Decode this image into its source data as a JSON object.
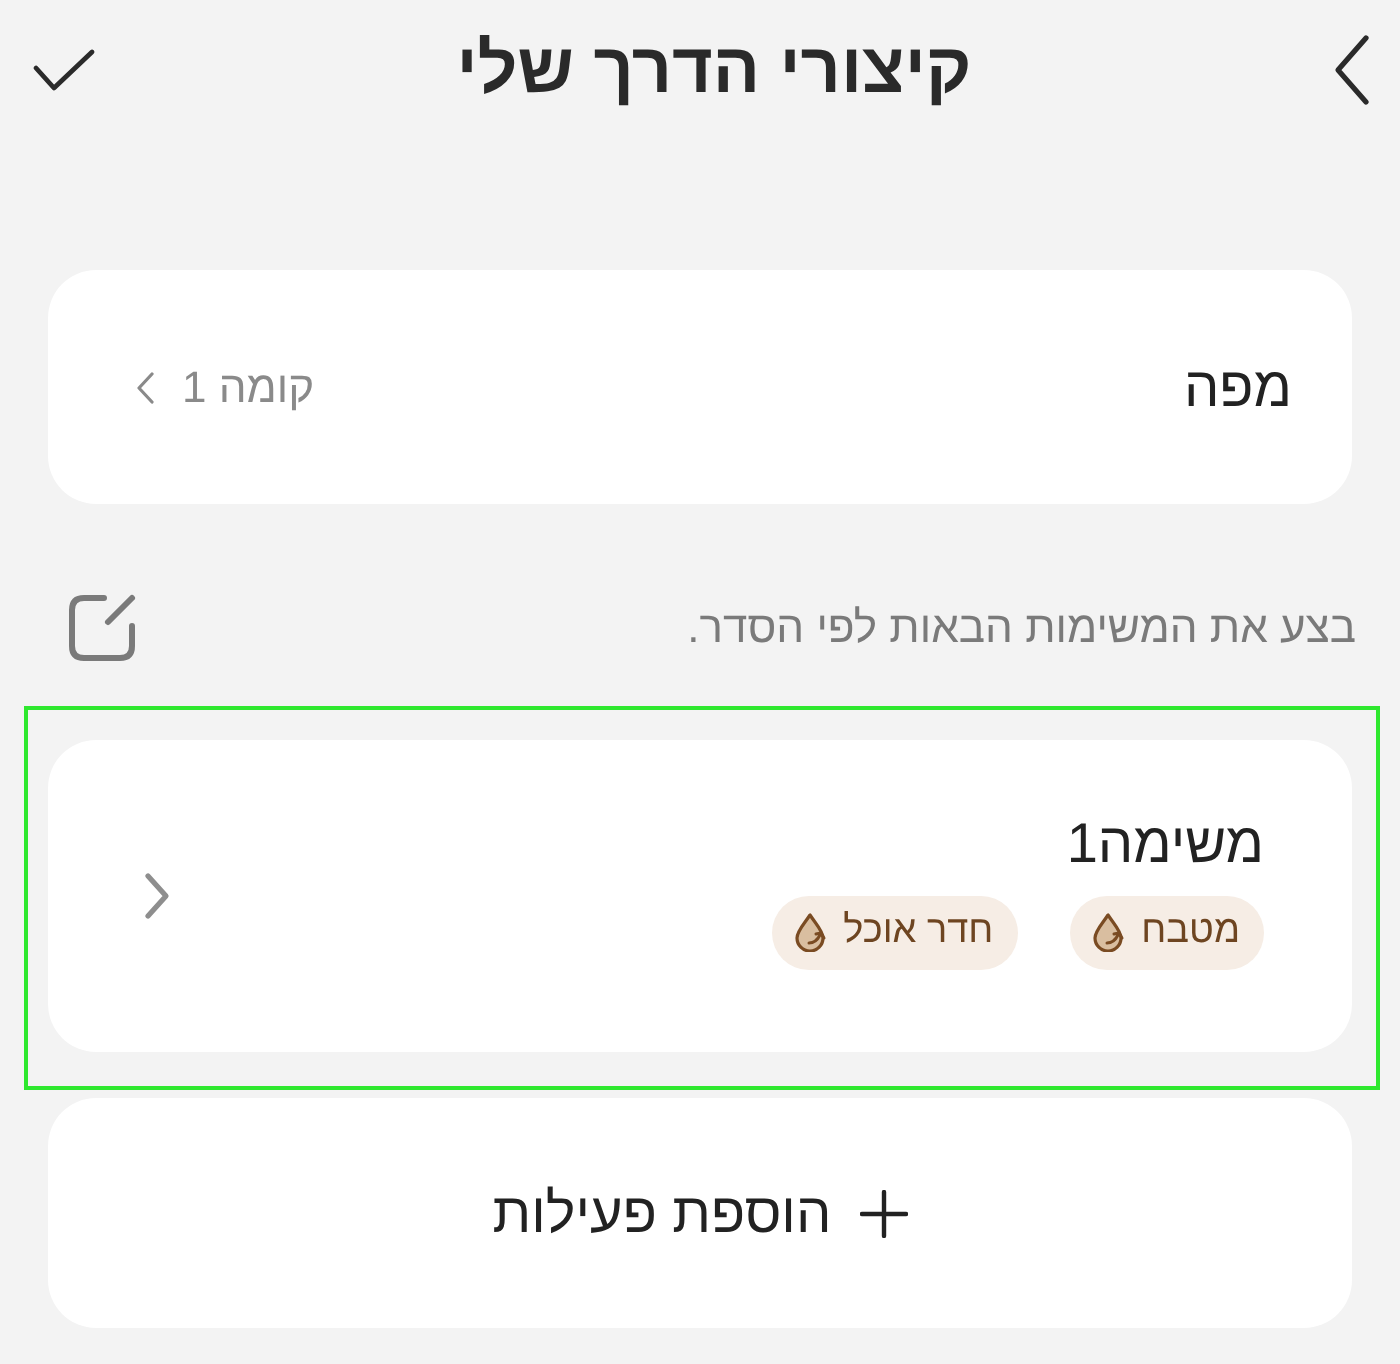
{
  "header": {
    "title": "קיצורי הדרך שלי"
  },
  "map": {
    "label": "מפה",
    "value": "קומה 1"
  },
  "instruction": "בצע את המשימות הבאות לפי הסדר.",
  "tasks": [
    {
      "title": "משימה1",
      "selected": true,
      "tags": [
        "מטבח",
        "חדר אוכל"
      ]
    }
  ],
  "add_button": {
    "label": "הוספת פעילות"
  }
}
